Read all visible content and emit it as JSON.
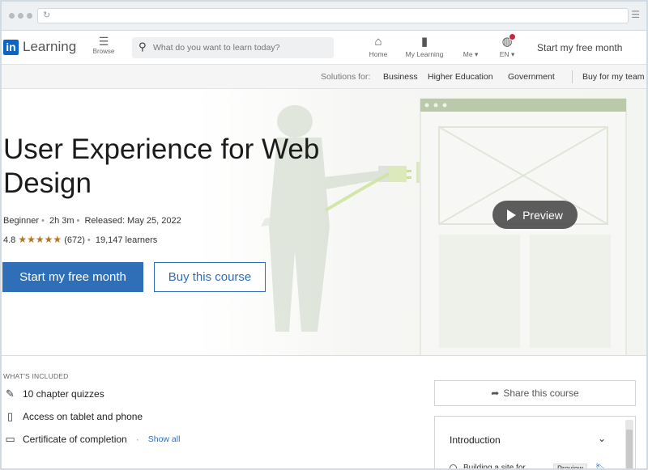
{
  "nav": {
    "logo_text": "Learning",
    "browse_label": "Browse",
    "search_placeholder": "What do you want to learn today?",
    "home_label": "Home",
    "my_learning_label": "My Learning",
    "me_label": "Me",
    "lang_label": "EN",
    "free_month": "Start my free month"
  },
  "subnav": {
    "solutions_label": "Solutions for:",
    "business": "Business",
    "higher_ed": "Higher Education",
    "government": "Government",
    "buy_for_team": "Buy for my team"
  },
  "hero": {
    "title": "User Experience for Web Design",
    "level": "Beginner",
    "duration": "2h 3m",
    "released": "Released: May 25, 2022",
    "rating": "4.8",
    "stars": "★★★★★",
    "reviews": "(672)",
    "learners": "19,147 learners",
    "primary_button": "Start my free month",
    "secondary_button": "Buy this course",
    "preview_label": "Preview"
  },
  "included": {
    "heading": "WHAT'S INCLUDED",
    "items": [
      {
        "icon": "quiz-icon",
        "label": "10 chapter quizzes"
      },
      {
        "icon": "tablet-icon",
        "label": "Access on tablet and phone"
      },
      {
        "icon": "certificate-icon",
        "label": "Certificate of completion"
      }
    ],
    "show_all": "Show all"
  },
  "sidebar": {
    "share_label": "Share this course",
    "section_title": "Introduction",
    "first_item": "Building a site for",
    "preview_badge": "Preview"
  },
  "colors": {
    "brand": "#0a66c2",
    "primary_button": "#2e6fb7",
    "star": "#b8751f",
    "notification": "#c7253b"
  }
}
